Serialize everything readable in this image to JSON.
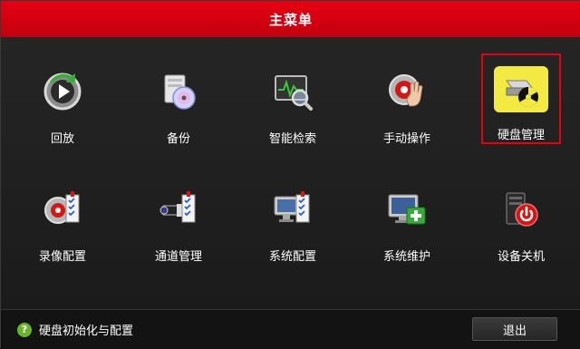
{
  "window": {
    "title": "主菜单"
  },
  "menu": {
    "items": [
      {
        "label": "回放",
        "icon": "playback-icon"
      },
      {
        "label": "备份",
        "icon": "backup-disc-icon"
      },
      {
        "label": "智能检索",
        "icon": "smart-search-icon"
      },
      {
        "label": "手动操作",
        "icon": "manual-operation-icon"
      },
      {
        "label": "硬盘管理",
        "icon": "hdd-management-icon",
        "selected": true
      },
      {
        "label": "录像配置",
        "icon": "record-config-icon"
      },
      {
        "label": "通道管理",
        "icon": "channel-management-icon"
      },
      {
        "label": "系统配置",
        "icon": "system-config-icon"
      },
      {
        "label": "系统维护",
        "icon": "system-maintenance-icon"
      },
      {
        "label": "设备关机",
        "icon": "device-shutdown-icon"
      }
    ]
  },
  "status": {
    "hint": "硬盘初始化与配置",
    "hint_icon": "help-icon"
  },
  "buttons": {
    "exit": "退出"
  },
  "colors": {
    "accent": "#e60012",
    "selected_icon_bg": "#f2ea42",
    "hint_icon": "#6bb52e"
  }
}
